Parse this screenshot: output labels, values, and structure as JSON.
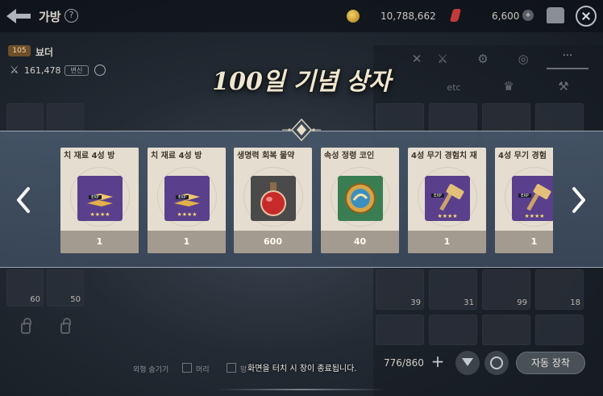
{
  "header": {
    "title": "가방",
    "help_glyph": "?",
    "gold_amount": "10,788,662",
    "gem_amount": "6,600",
    "gem_add_glyph": "+",
    "icons": [
      "back-icon",
      "help-icon",
      "gold-coin-icon",
      "red-gem-icon",
      "chest-icon",
      "close-icon"
    ]
  },
  "character": {
    "level": "105",
    "name": "뵤더",
    "power_value": "161,478",
    "power_tag": "변신"
  },
  "left_slots": [
    {
      "count": ""
    },
    {
      "count": ""
    },
    {
      "count": "60"
    },
    {
      "count": "50"
    }
  ],
  "right_panel": {
    "more_label": "···",
    "etc_label": "etc",
    "slot_counts": [
      "39",
      "31",
      "99",
      "18"
    ]
  },
  "bottom": {
    "count_display": "776/860",
    "add_label": "+",
    "auto_equip_label": "자동 장착",
    "hide_look_label": "외형 숨기기",
    "hair_label": "머리",
    "hat_label": "망",
    "dismiss_hint": "화면을 터치 시 창이 종료됩니다."
  },
  "popup": {
    "title": "100일 기념 상자",
    "cards": [
      {
        "name": "치 재료   4성 방",
        "qty": "1",
        "icon": "exp-gold-bars-icon",
        "box_color": "#5a3f8c"
      },
      {
        "name": "치 재료   4성 방",
        "qty": "1",
        "icon": "exp-gold-bars-icon",
        "box_color": "#5a3f8c"
      },
      {
        "name": "생명력 회복 물약",
        "qty": "600",
        "icon": "red-potion-icon",
        "box_color": "#4a4a4a"
      },
      {
        "name": "속성 정령 코인",
        "qty": "40",
        "icon": "spirit-coin-icon",
        "box_color": "#3a7d52"
      },
      {
        "name": "4성 무기 경험치 재",
        "qty": "1",
        "icon": "exp-hammer-icon",
        "box_color": "#5a3f8c"
      },
      {
        "name": "4성 무기 경험",
        "qty": "1",
        "icon": "exp-hammer-icon",
        "box_color": "#5a3f8c"
      }
    ],
    "exp_tag": "EXP",
    "stars": "★★★★"
  }
}
